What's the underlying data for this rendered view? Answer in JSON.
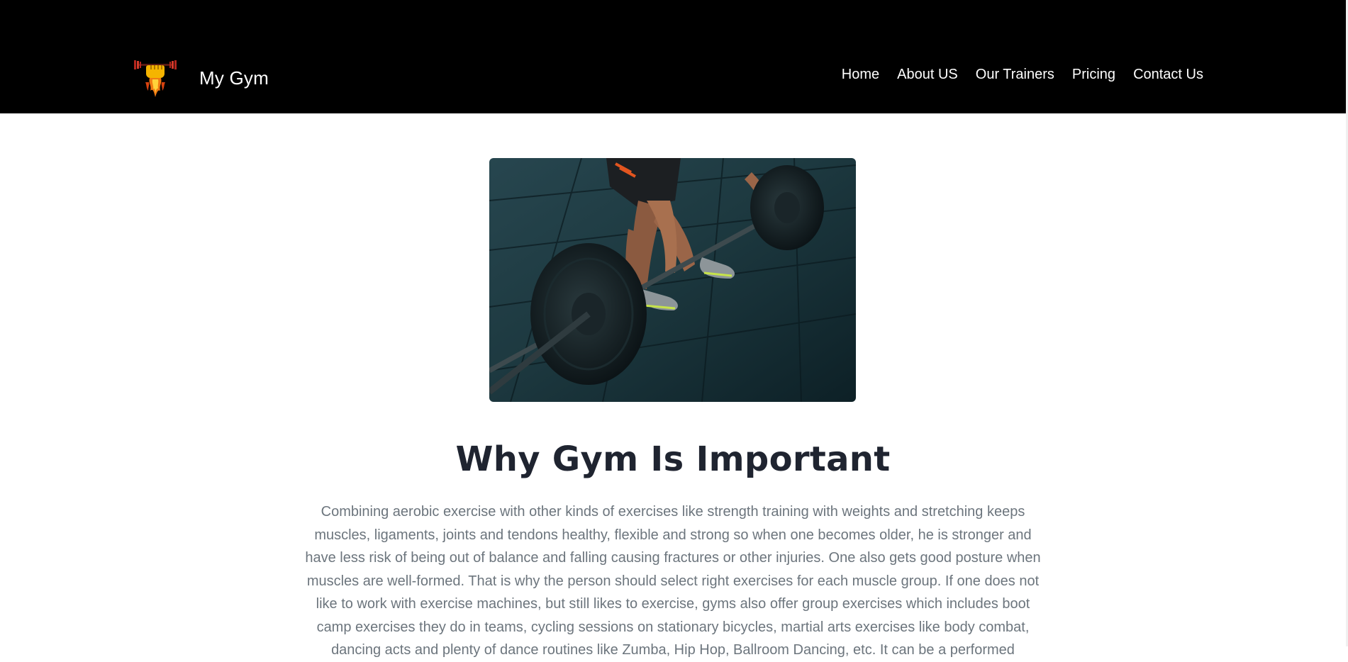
{
  "brand": {
    "name": "My Gym",
    "logo_icon": "flaming-fist-barbell-icon"
  },
  "nav": {
    "items": [
      {
        "label": "Home"
      },
      {
        "label": "About US"
      },
      {
        "label": "Our Trainers"
      },
      {
        "label": "Pricing"
      },
      {
        "label": "Contact Us"
      }
    ]
  },
  "hero": {
    "image": "deadlift-barbell-photo"
  },
  "section": {
    "title": "Why Gym Is Important",
    "body": "Combining aerobic exercise with other kinds of exercises like strength training with weights and stretching keeps muscles, ligaments, joints and tendons healthy, flexible and strong so when one becomes older, he is stronger and have less risk of being out of balance and falling causing fractures or other injuries. One also gets good posture when muscles are well-formed. That is why the person should select right exercises for each muscle group. If one does not like to work with exercise machines, but still likes to exercise, gyms also offer group exercises which includes boot camp exercises they do in teams, cycling sessions on stationary bicycles, martial arts exercises like body combat, dancing acts and plenty of dance routines like Zumba, Hip Hop, Ballroom Dancing, etc. It can be a performed"
  },
  "colors": {
    "navbar_bg": "#000000",
    "heading": "#1f2430",
    "body_text": "#6c757d"
  }
}
